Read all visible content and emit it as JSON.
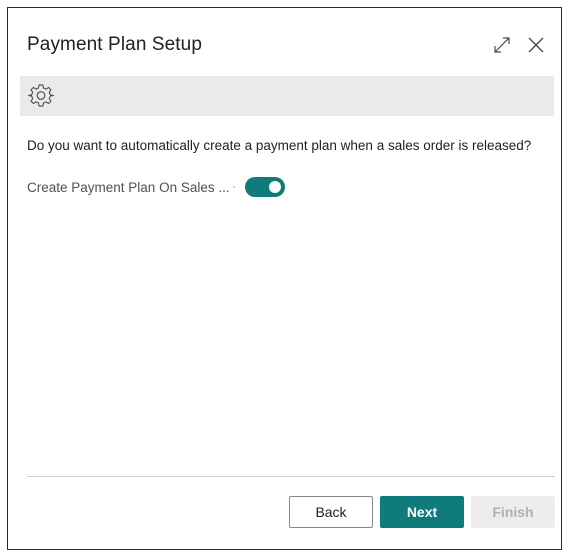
{
  "dialog": {
    "title": "Payment Plan Setup",
    "question": "Do you want to automatically create a payment plan when a sales order is released?",
    "field": {
      "label": "Create Payment Plan On Sales ...",
      "enabled": true
    }
  },
  "buttons": {
    "back": "Back",
    "next": "Next",
    "finish": "Finish"
  },
  "icons": {
    "expand": "expand-icon",
    "close": "close-icon",
    "settings": "gear-icon"
  },
  "colors": {
    "accent": "#0f7b7b",
    "toolbar_bg": "#eaeaea",
    "disabled_bg": "#ededed"
  }
}
